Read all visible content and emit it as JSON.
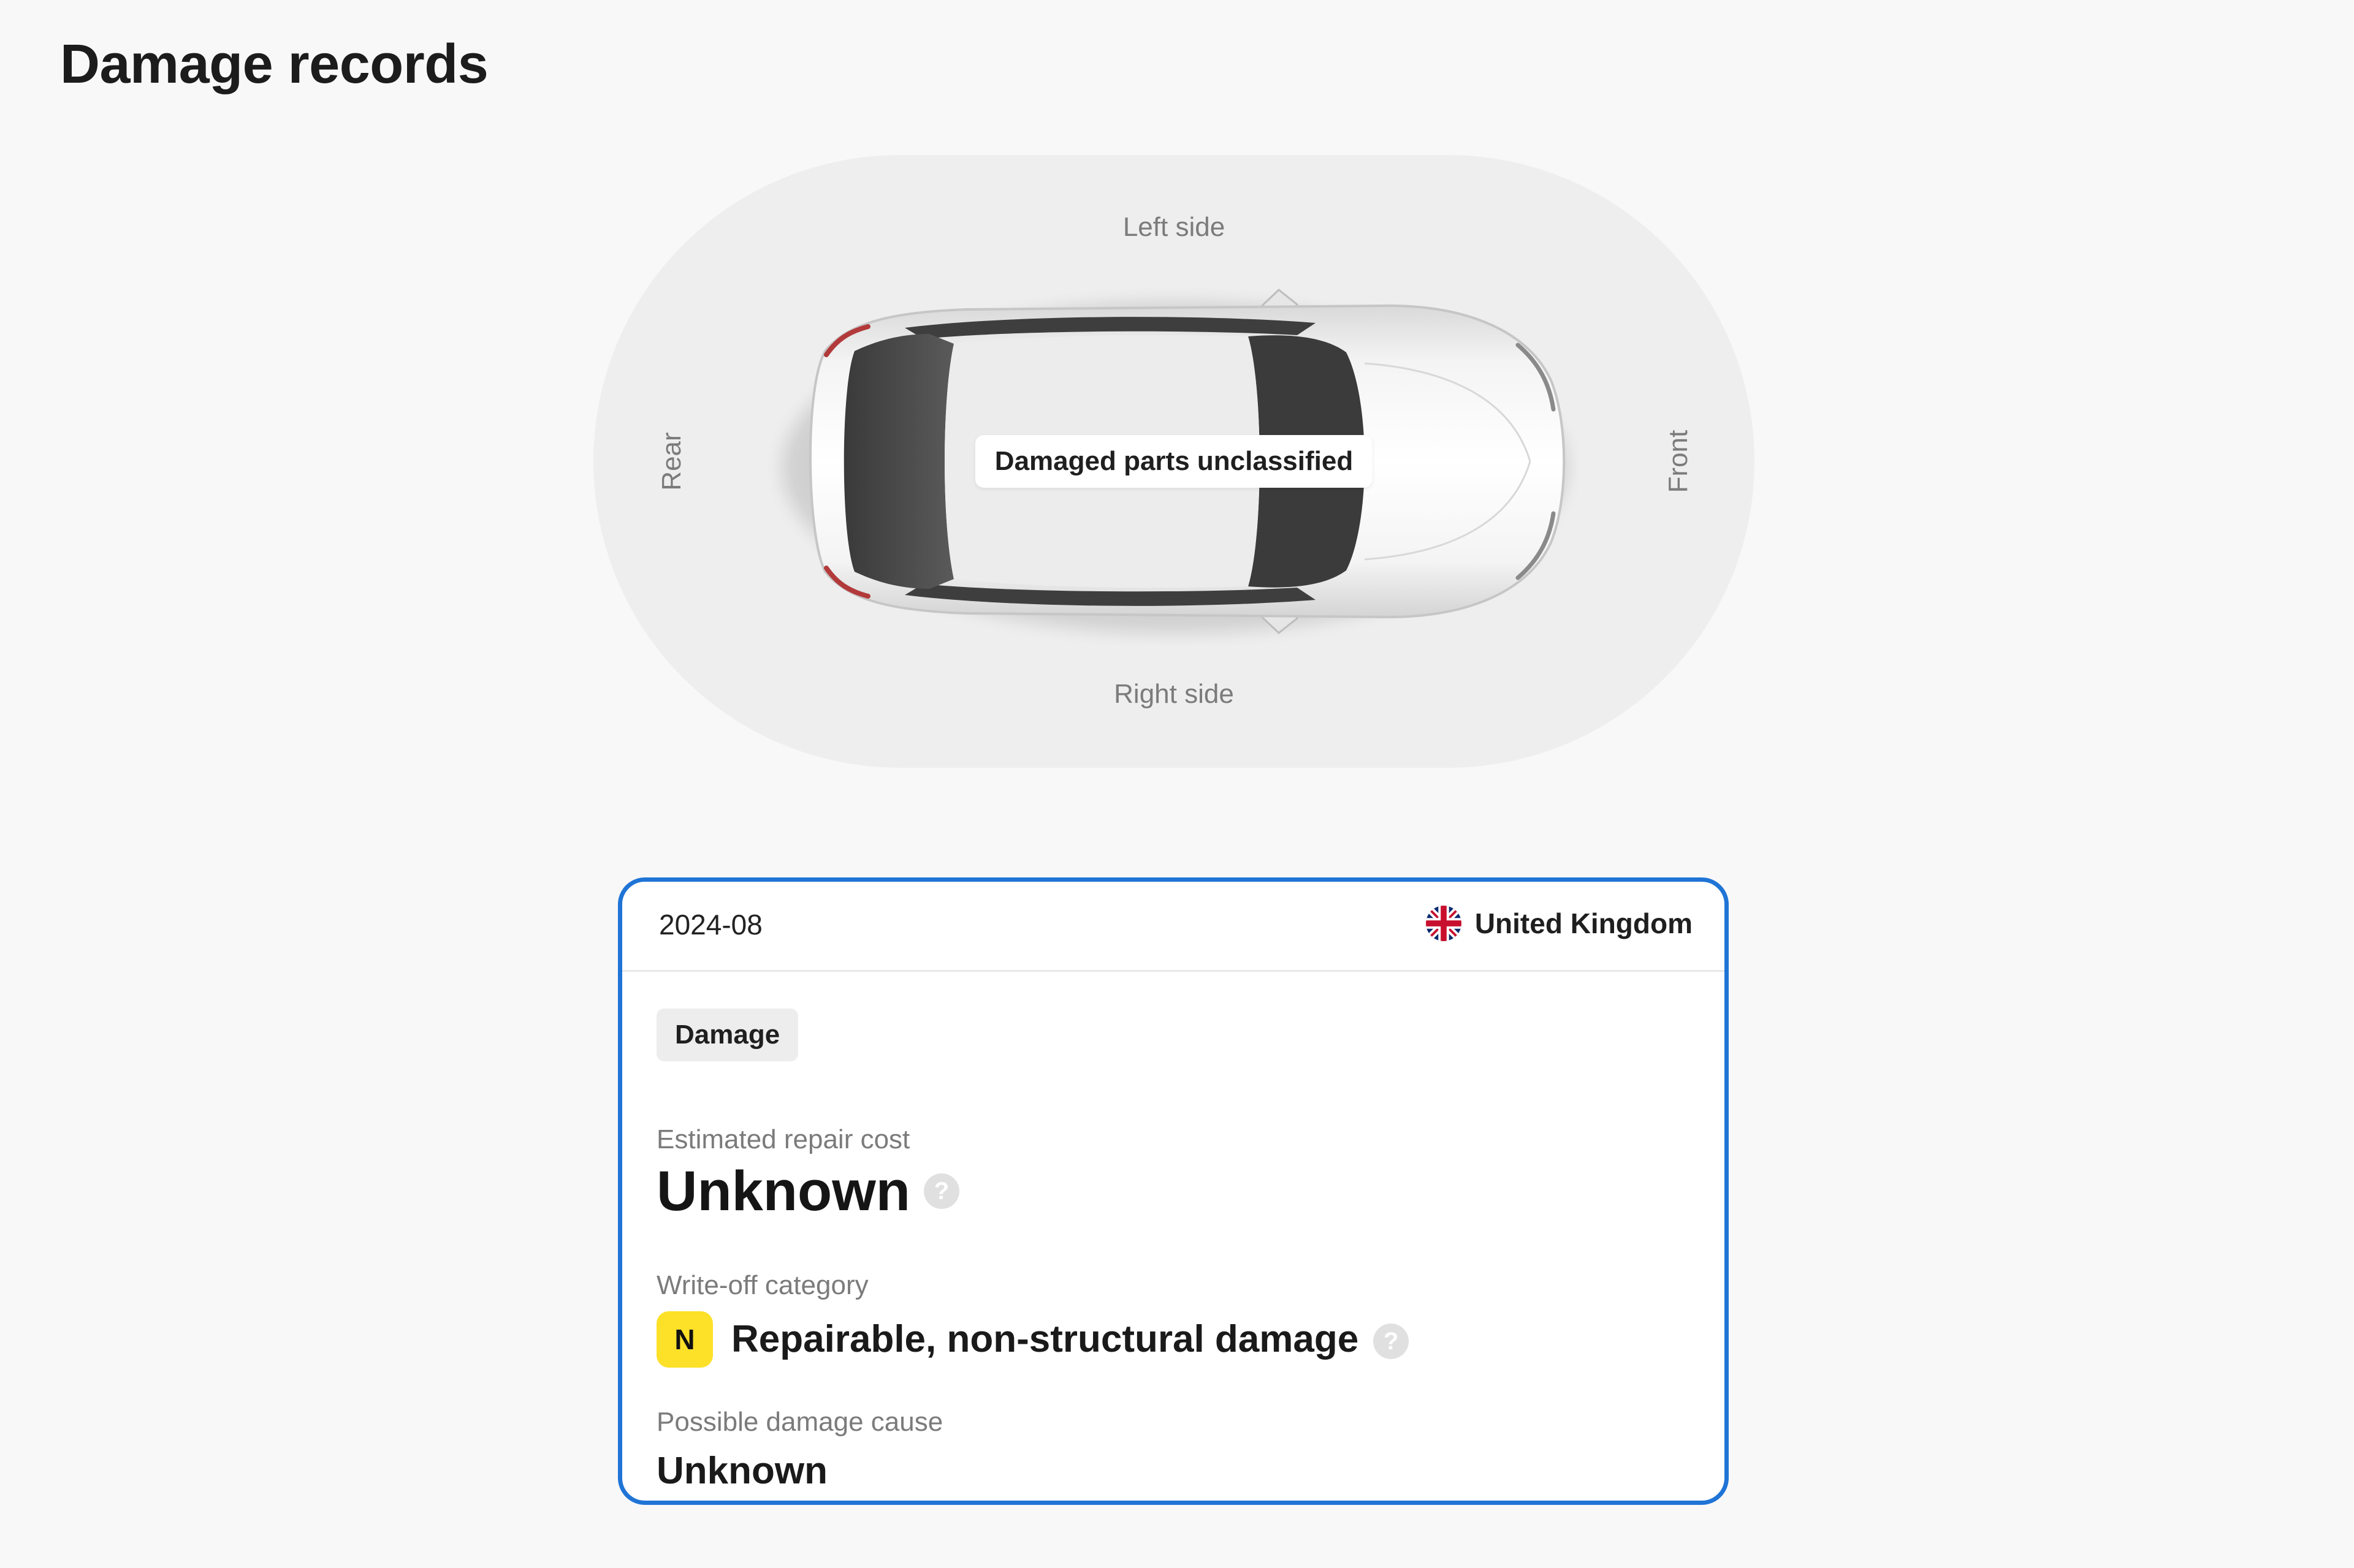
{
  "page": {
    "title": "Damage records"
  },
  "diagram": {
    "labels": {
      "left_side": "Left side",
      "right_side": "Right side",
      "rear": "Rear",
      "front": "Front"
    },
    "damage_status": "Damaged parts unclassified",
    "car_icon": "car-top-view-icon"
  },
  "record": {
    "date": "2024-08",
    "country": {
      "name": "United Kingdom",
      "flag_icon": "uk-flag-icon"
    },
    "type_badge": "Damage",
    "repair_cost": {
      "label": "Estimated repair cost",
      "value": "Unknown",
      "help_icon": "question-mark-icon"
    },
    "write_off": {
      "label": "Write-off category",
      "badge": "N",
      "value": "Repairable, non-structural damage",
      "badge_color": "#fde028",
      "help_icon": "question-mark-icon"
    },
    "damage_cause": {
      "label": "Possible damage cause",
      "value": "Unknown"
    }
  },
  "colors": {
    "card_border": "#1f74d6",
    "page_background": "#f8f8f8",
    "diagram_background": "#eeeeee"
  }
}
